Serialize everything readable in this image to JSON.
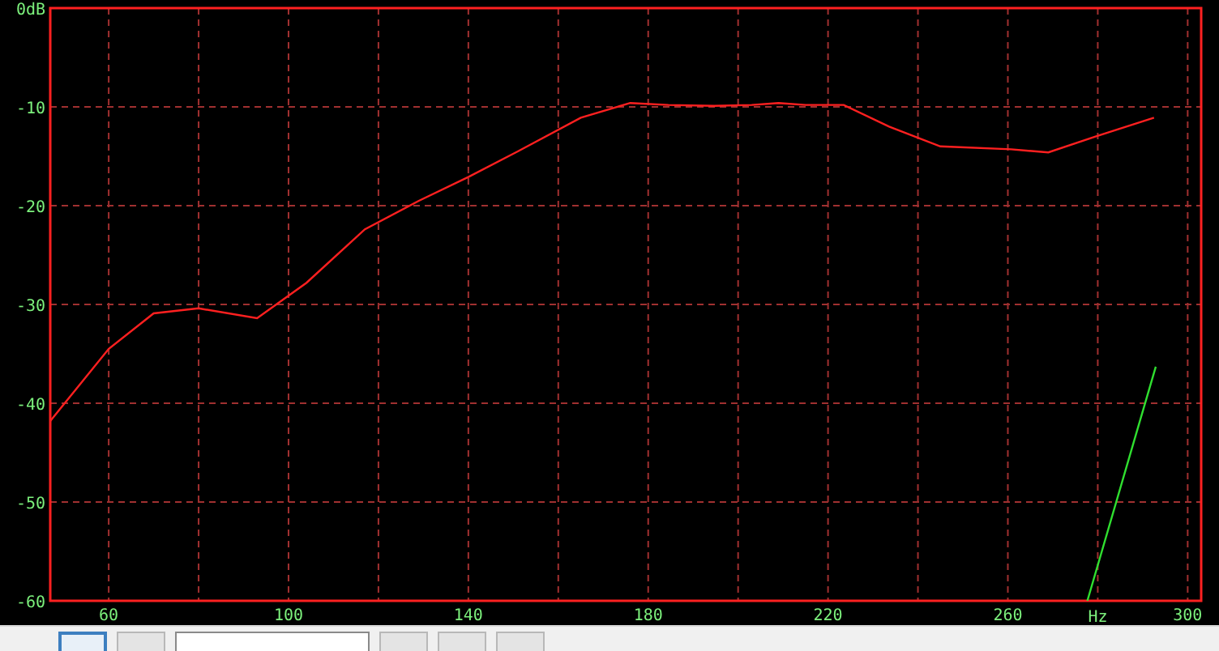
{
  "chart": {
    "chart_data": {
      "type": "line",
      "xlabel": "Hz",
      "grid": true,
      "xlim": [
        47,
        303
      ],
      "ylim": [
        -60,
        0
      ],
      "xticks": [
        60,
        100,
        140,
        180,
        220,
        260,
        300
      ],
      "yticks": [
        {
          "value": 0,
          "label": "0dB"
        },
        -10,
        -20,
        -30,
        -40,
        -50,
        -60
      ],
      "series": [
        {
          "color": "#ff2020",
          "x": [
            47,
            60,
            70,
            80,
            93,
            104,
            117,
            129,
            140,
            151,
            165,
            176,
            184.5,
            194.7,
            203,
            209,
            215,
            223.5,
            233.6,
            245,
            260.7,
            269,
            279.5,
            292.5
          ],
          "values": [
            -41.8,
            -34.5,
            -30.9,
            -30.4,
            -31.4,
            -27.8,
            -22.4,
            -19.5,
            -17.1,
            -14.5,
            -11.1,
            -9.6,
            -9.8,
            -9.9,
            -9.8,
            -9.6,
            -9.8,
            -9.8,
            -12,
            -14,
            -14.3,
            -14.6,
            -13,
            -11.1
          ]
        },
        {
          "color": "#30e030",
          "x": [
            277.7,
            292.9
          ],
          "values": [
            -60,
            -36.3
          ]
        }
      ]
    }
  },
  "toolbar": {
    "controls": [
      {
        "kind": "button",
        "selected": true
      },
      {
        "kind": "button",
        "selected": false
      },
      {
        "kind": "field"
      },
      {
        "kind": "button",
        "selected": false
      },
      {
        "kind": "button",
        "selected": false
      },
      {
        "kind": "button",
        "selected": false
      }
    ]
  }
}
